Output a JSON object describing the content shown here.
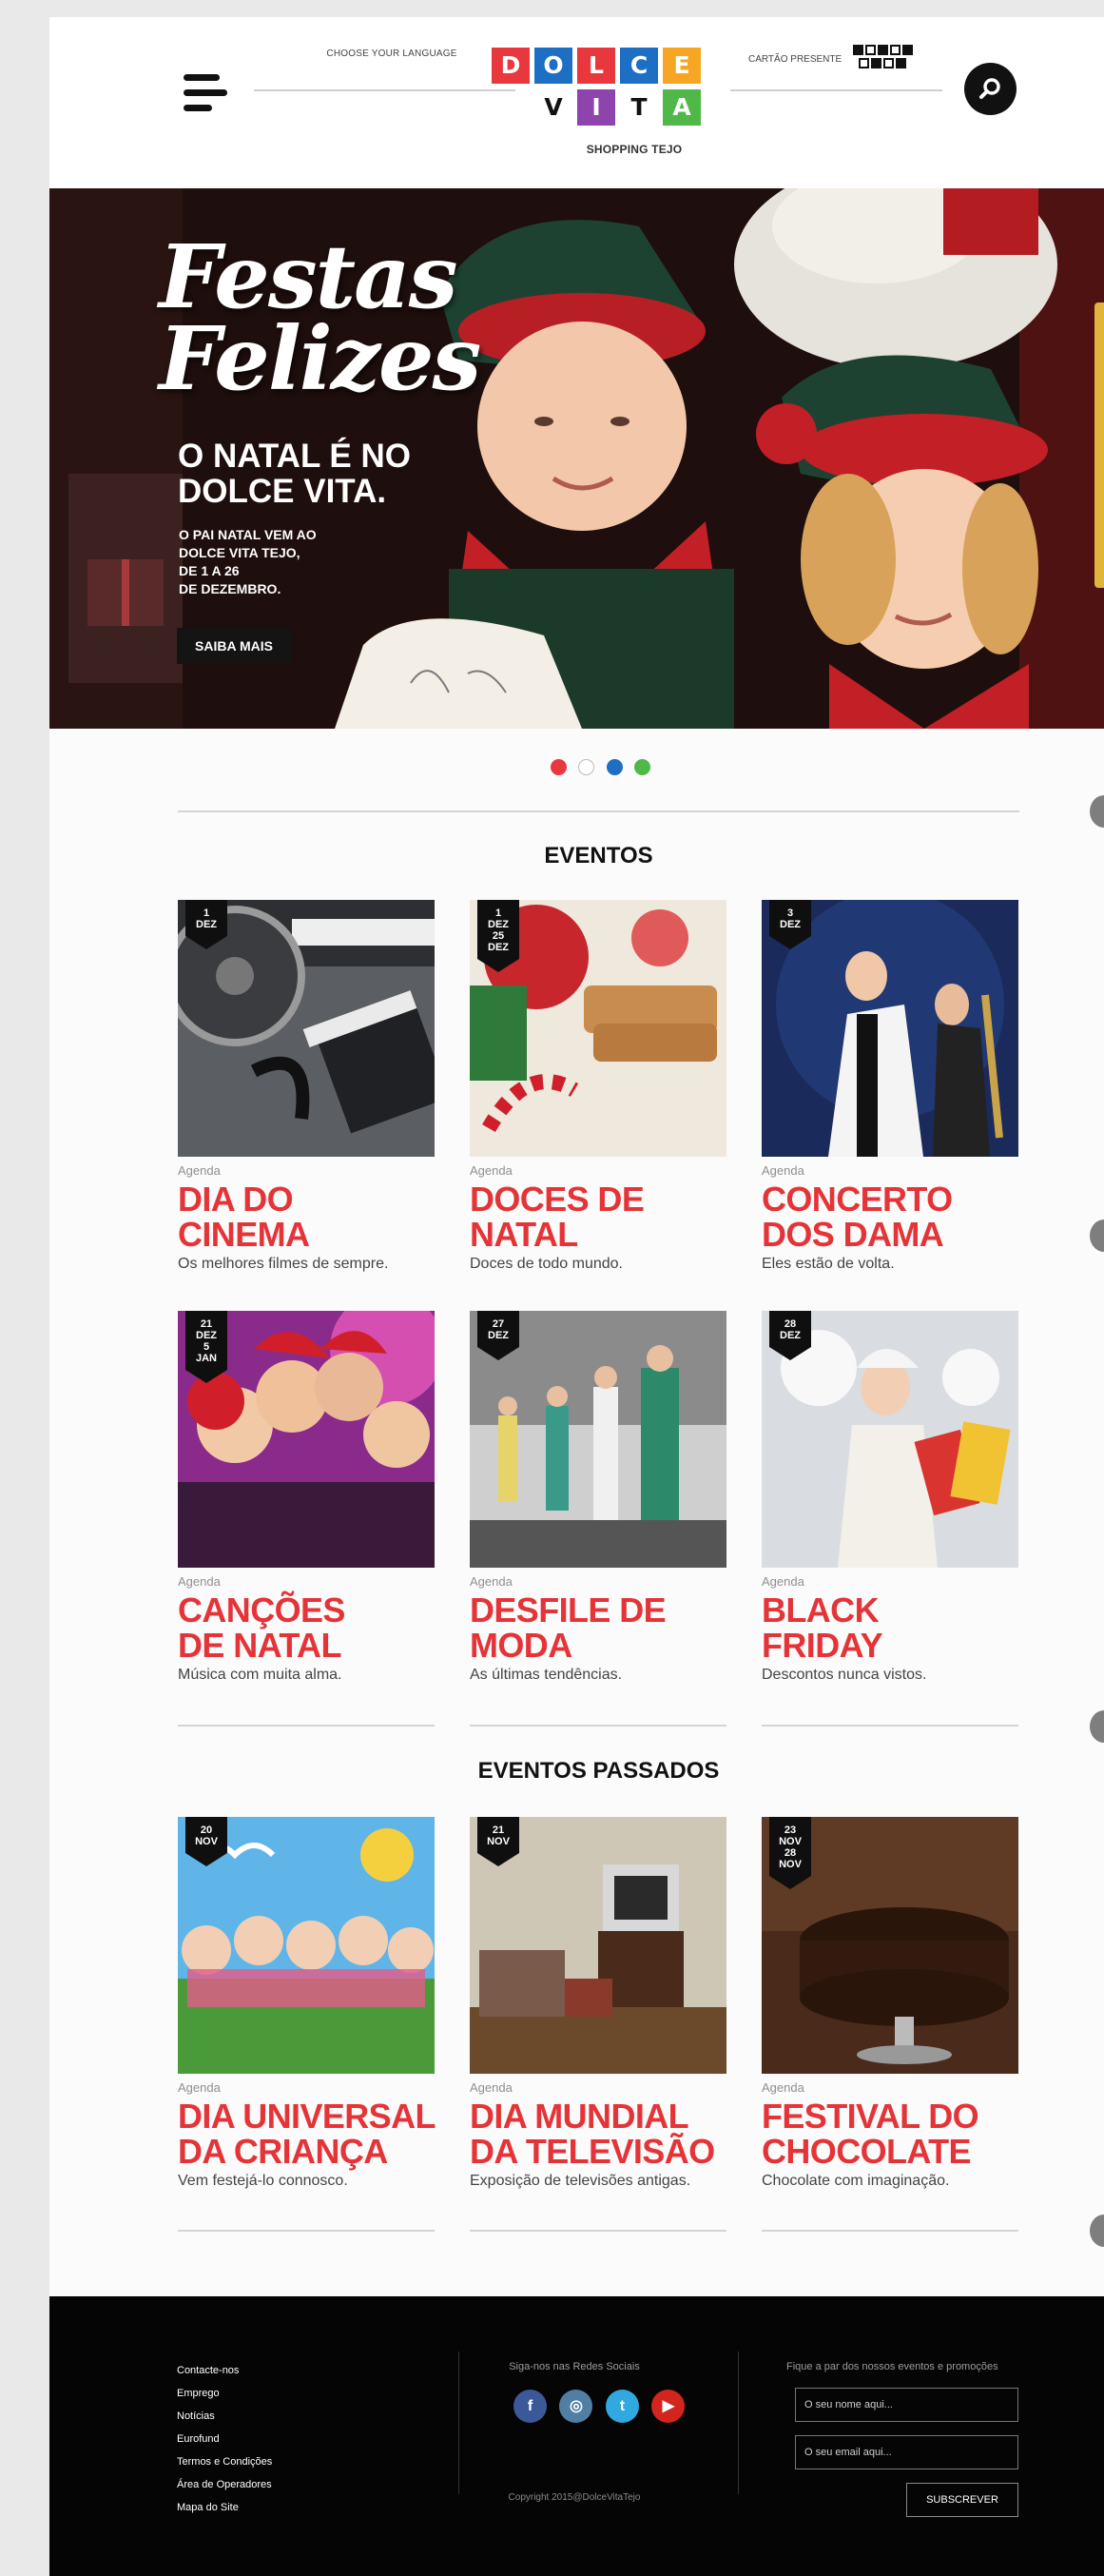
{
  "header": {
    "language_label": "Choose your language",
    "gift_card_label": "Cartão Presente",
    "logo": {
      "tiles": [
        "D",
        "O",
        "L",
        "C",
        "E",
        "V",
        "I",
        "T",
        "A"
      ],
      "subtitle": "SHOPPING TEJO"
    }
  },
  "hero": {
    "title_line1": "Festas",
    "title_line2": "Felizes",
    "subtitle": "O NATAL É NO DOLCE VITA.",
    "small_line1": "O PAI NATAL VEM AO",
    "small_line2": "DOLCE VITA TEJO,",
    "small_line3": "DE 1 A 26",
    "small_line4": "DE DEZEMBRO.",
    "button": "SAIBA MAIS",
    "dot_colors": [
      "#e8373d",
      "#ffffff",
      "#1d6fc4",
      "#4fb848"
    ]
  },
  "eventos": {
    "title": "EVENTOS",
    "items": [
      {
        "badge_day": "1",
        "badge_month": "DEZ",
        "badge_day2": "",
        "badge_month2": "",
        "category": "Agenda",
        "title_line1": "DIA DO",
        "title_line2": "CINEMA",
        "desc": "Os melhores filmes de sempre."
      },
      {
        "badge_day": "1",
        "badge_month": "DEZ",
        "badge_day2": "25",
        "badge_month2": "DEZ",
        "category": "Agenda",
        "title_line1": "DOCES DE",
        "title_line2": "NATAL",
        "desc": "Doces de todo mundo."
      },
      {
        "badge_day": "3",
        "badge_month": "DEZ",
        "badge_day2": "",
        "badge_month2": "",
        "category": "Agenda",
        "title_line1": "CONCERTO",
        "title_line2": "DOS DAMA",
        "desc": "Eles estão de volta."
      },
      {
        "badge_day": "21",
        "badge_month": "DEZ",
        "badge_day2": "5",
        "badge_month2": "JAN",
        "category": "Agenda",
        "title_line1": "CANÇÕES",
        "title_line2": "DE NATAL",
        "desc": "Música com muita alma."
      },
      {
        "badge_day": "27",
        "badge_month": "DEZ",
        "badge_day2": "",
        "badge_month2": "",
        "category": "Agenda",
        "title_line1": "DESFILE DE",
        "title_line2": "MODA",
        "desc": "As últimas tendências."
      },
      {
        "badge_day": "28",
        "badge_month": "DEZ",
        "badge_day2": "",
        "badge_month2": "",
        "category": "Agenda",
        "title_line1": "BLACK",
        "title_line2": "FRIDAY",
        "desc": "Descontos nunca vistos."
      }
    ]
  },
  "eventos_passados": {
    "title": "EVENTOS PASSADOS",
    "items": [
      {
        "badge_day": "20",
        "badge_month": "NOV",
        "badge_day2": "",
        "badge_month2": "",
        "category": "Agenda",
        "title_line1": "DIA UNIVERSAL",
        "title_line2": "DA CRIANÇA",
        "desc": "Vem festejá-lo connosco."
      },
      {
        "badge_day": "21",
        "badge_month": "NOV",
        "badge_day2": "",
        "badge_month2": "",
        "category": "Agenda",
        "title_line1": "DIA MUNDIAL",
        "title_line2": "DA TELEVISÃO",
        "desc": "Exposição de televisões antigas."
      },
      {
        "badge_day": "23",
        "badge_month": "NOV",
        "badge_day2": "28",
        "badge_month2": "NOV",
        "category": "Agenda",
        "title_line1": "FESTIVAL DO",
        "title_line2": "CHOCOLATE",
        "desc": "Chocolate com imaginação."
      }
    ]
  },
  "footer": {
    "links": [
      "Contacte-nos",
      "Emprego",
      "Notícias",
      "Eurofund",
      "Termos e Condições",
      "Área de Operadores",
      "Mapa do Site"
    ],
    "social_label": "Siga-nos nas Redes Sociais",
    "social_icons": [
      "facebook-icon",
      "instagram-icon",
      "twitter-icon",
      "youtube-icon"
    ],
    "social_glyphs": [
      "f",
      "◎",
      "t",
      "▶"
    ],
    "social_colors": [
      "#3b5998",
      "#517fa4",
      "#2fa9e0",
      "#d3241d"
    ],
    "copyright": "Copyright 2015@DolceVitaTejo",
    "newsletter_label": "Fique a par dos nossos eventos e promoções",
    "name_placeholder": "O seu nome aqui...",
    "email_placeholder": "O seu email aqui...",
    "subscribe_button": "SUBSCREVER"
  }
}
